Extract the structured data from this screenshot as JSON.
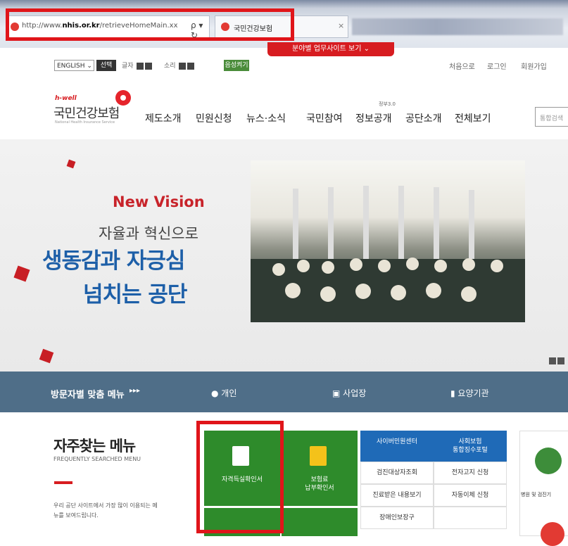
{
  "browser": {
    "url_prefix": "http://www.",
    "url_domain": "nhis.or.kr",
    "url_suffix": "/retrieveHomeMain.xx",
    "tools": "ρ ▾ ↻",
    "tab_title": "국민건강보험",
    "tab_close": "×"
  },
  "util": {
    "dropdown": "분야별 업무사이트 보기 ⌄",
    "lang": "ENGLISH ⌄",
    "select_btn": "선택",
    "font_label": "글자",
    "sound_label": "소리",
    "voice_btn": "음성켜기",
    "links": [
      "처음으로",
      "로그인",
      "회원가입"
    ]
  },
  "logo": {
    "hwell": "h-well",
    "name": "국민건강보험",
    "sub": "National Health Insurance Service"
  },
  "nav": {
    "badge": "정부3.0",
    "items": [
      "제도소개",
      "민원신청",
      "뉴스·소식",
      "국민참여",
      "정보공개",
      "공단소개",
      "전체보기"
    ],
    "search_placeholder": "통합검색"
  },
  "hero": {
    "new_vision": "New Vision",
    "line1": "자율과 혁신으로",
    "line2": "생동감과 자긍심",
    "line3": "넘치는 공단"
  },
  "visitor": {
    "title": "방문자별 맞춤 메뉴",
    "arrows": "▸▸▸",
    "items": [
      "개인",
      "사업장",
      "요양기관"
    ],
    "icons": [
      "person-icon",
      "building-icon",
      "bookmark-icon"
    ]
  },
  "frequent": {
    "title": "자주찾는 메뉴",
    "subtitle": "FREQUENTLY SEARCHED MENU",
    "desc": "우리 공단 사이트에서 가장 많이 이용되는 메뉴를 보여드립니다.",
    "tiles": [
      "자격득실확인서",
      "보험료\n납부확인서"
    ]
  },
  "quick": {
    "heads": [
      "사이버민원센터",
      "사회보험\n통합징수포털"
    ],
    "rows": [
      [
        "검진대상자조회",
        "전자고지 신청"
      ],
      [
        "진료받은 내용보기",
        "자동이체 신청"
      ],
      [
        "장애인보장구",
        ""
      ]
    ]
  },
  "right": {
    "label": "병원 및 검진기"
  },
  "colors": {
    "brand_red": "#d71c20",
    "nav_bar": "#4f6e88",
    "tile_green": "#2e8b2b",
    "quick_blue": "#1f6ab7",
    "headline_blue": "#1d5fa8"
  }
}
